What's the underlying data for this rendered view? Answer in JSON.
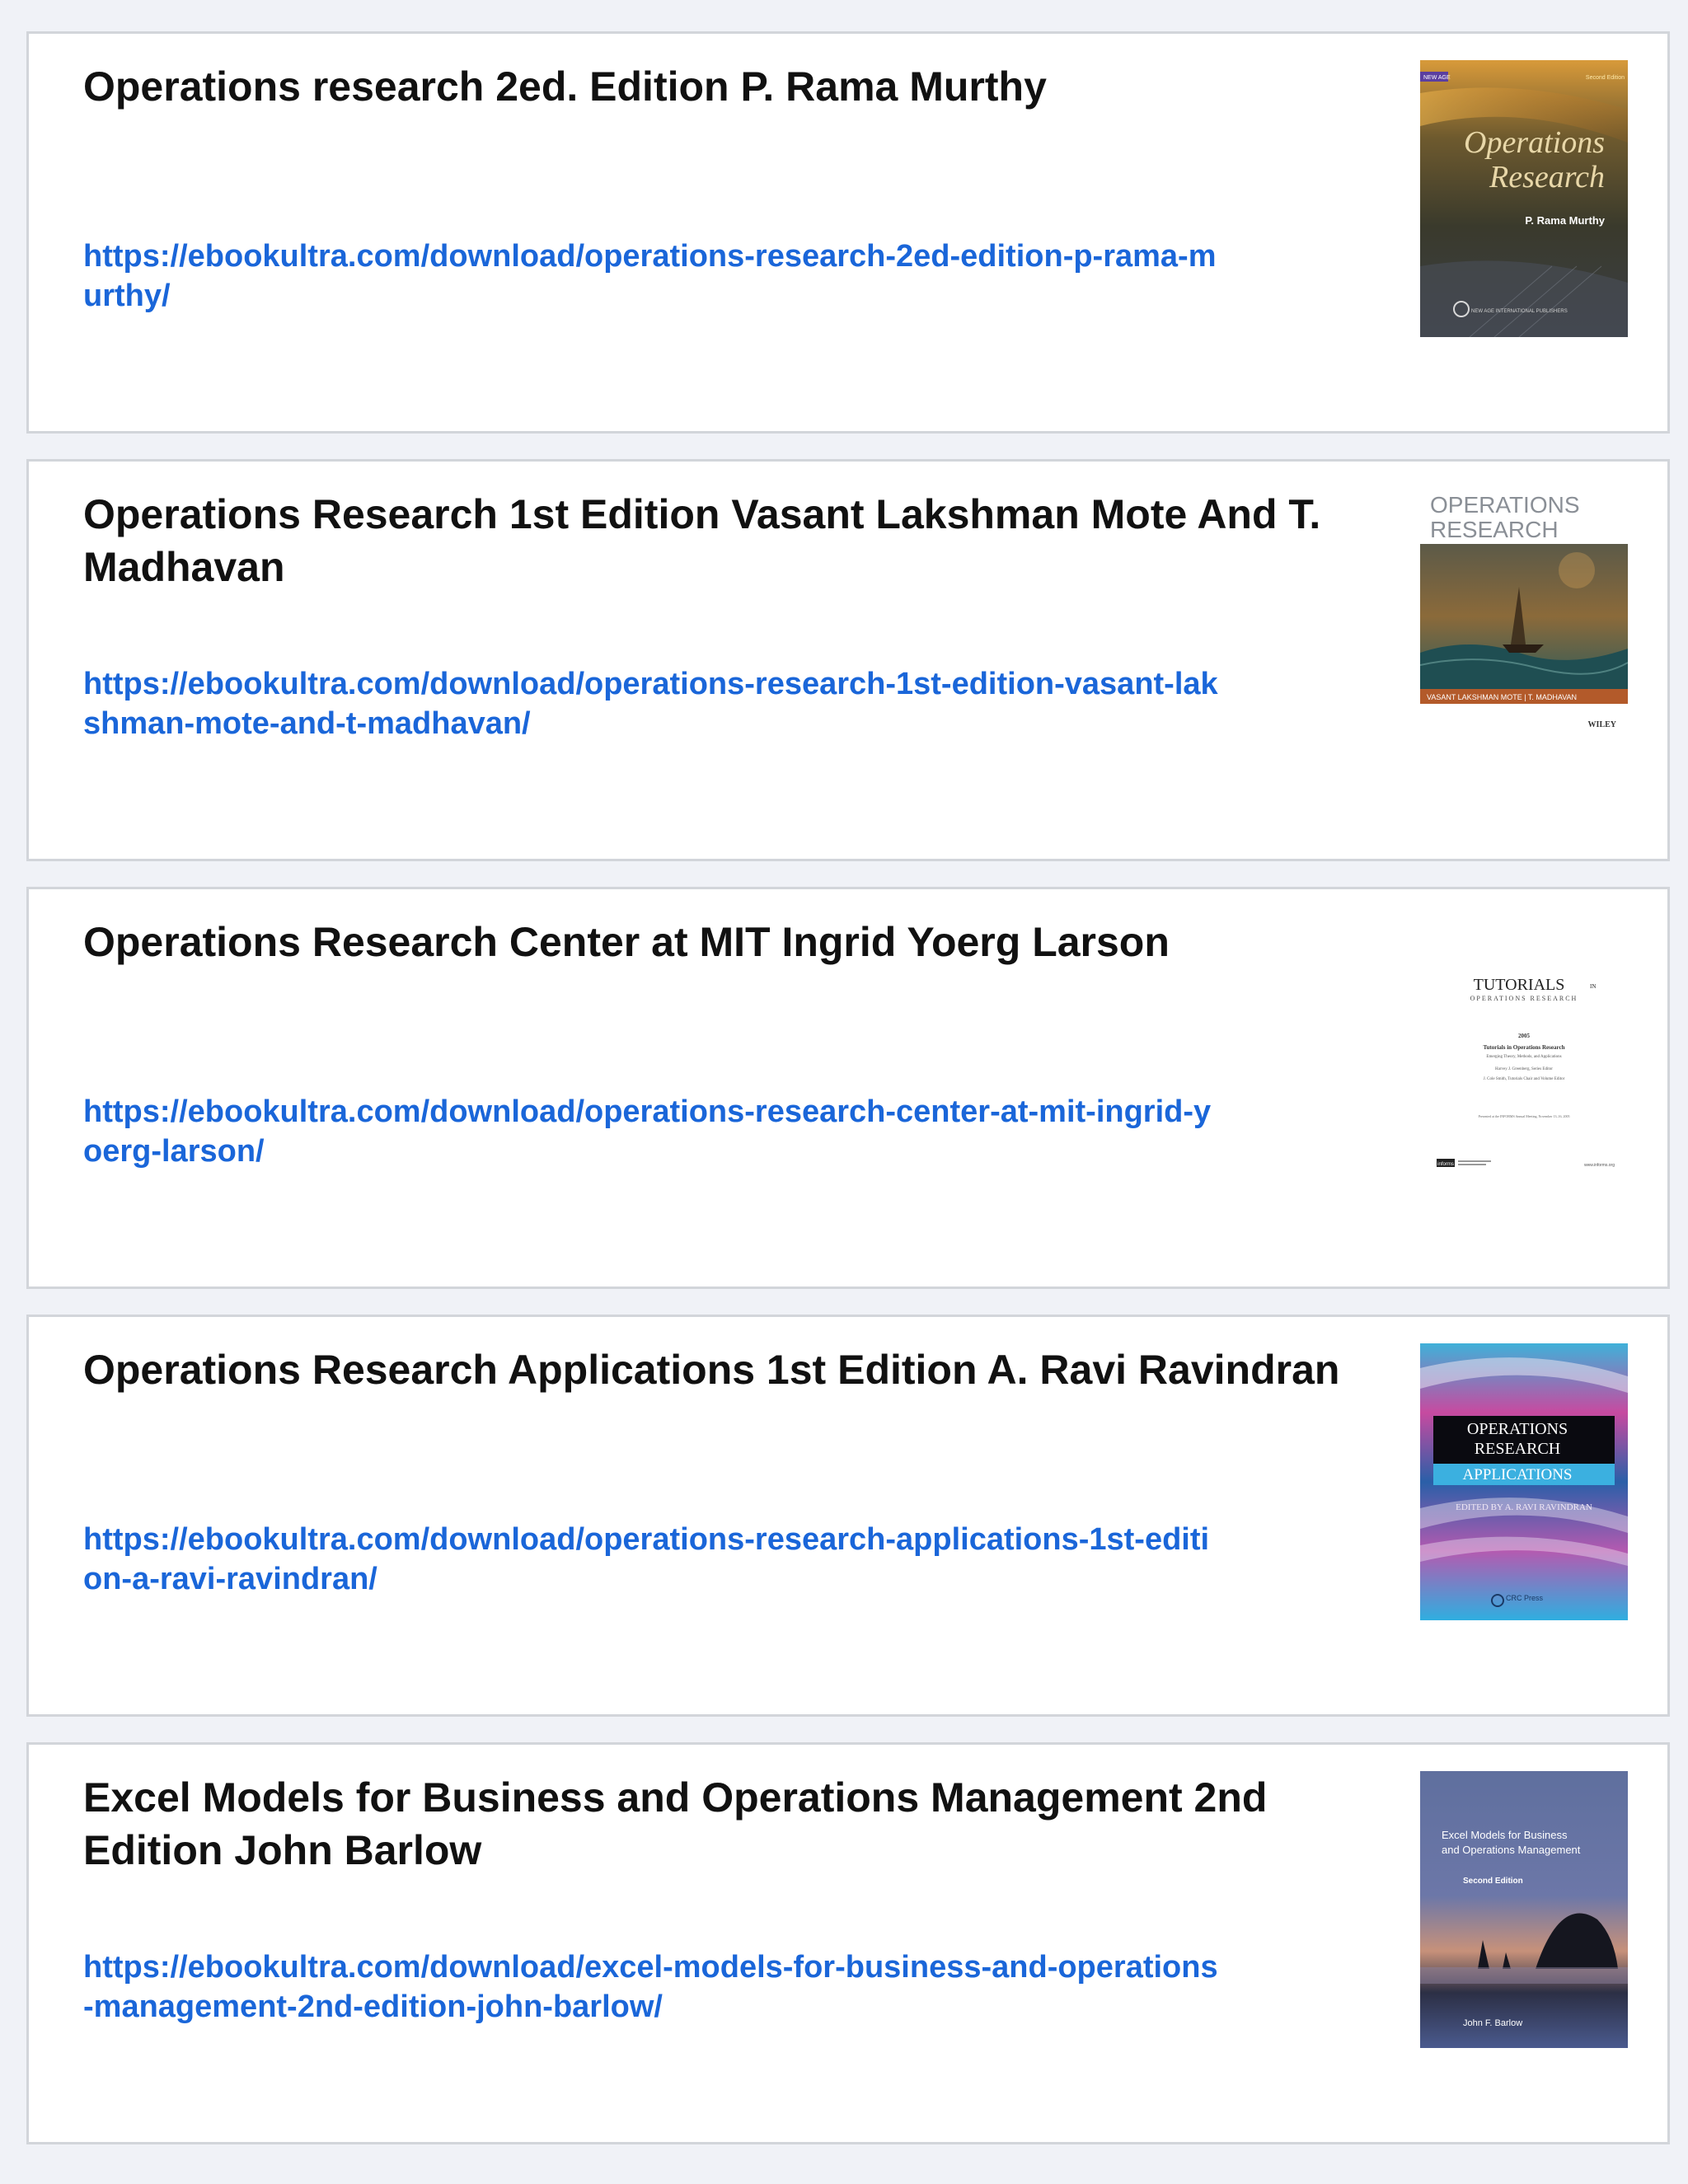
{
  "results": [
    {
      "title": "Operations research 2ed. Edition P. Rama Murthy",
      "url": "https://ebookultra.com/download/operations-research-2ed-edition-p-rama-murthy/",
      "cover": {
        "top_left_tag": "NEW AGE",
        "top_right_tag": "Second Edition",
        "title_line1": "Operations",
        "title_line2": "Research",
        "author": "P. Rama Murthy",
        "publisher": "NEW AGE INTERNATIONAL PUBLISHERS"
      }
    },
    {
      "title": "Operations Research 1st Edition Vasant Lakshman Mote And T. Madhavan",
      "url": "https://ebookultra.com/download/operations-research-1st-edition-vasant-lakshman-mote-and-t-madhavan/",
      "cover": {
        "title_line1": "OPERATIONS",
        "title_line2": "RESEARCH",
        "authors": "VASANT LAKSHMAN MOTE | T. MADHAVAN",
        "publisher": "WILEY"
      }
    },
    {
      "title": "Operations Research Center at MIT Ingrid Yoerg Larson",
      "url": "https://ebookultra.com/download/operations-research-center-at-mit-ingrid-yoerg-larson/",
      "cover": {
        "title": "TUTORIALS",
        "title_suffix": "IN",
        "subtitle": "OPERATIONS RESEARCH",
        "year": "2005",
        "heading": "Tutorials in Operations Research",
        "subheading": "Emerging Theory, Methods, and Applications",
        "editor_line1": "Harvey J. Greenberg, Series Editor",
        "editor_line2": "J. Cole Smith, Tutorials Chair and Volume Editor",
        "footer_note": "Presented at the INFORMS Annual Meeting, November 13–16, 2005",
        "footer_logo": "informs",
        "footer_url": "www.informs.org"
      }
    },
    {
      "title": "Operations Research Applications 1st Edition A. Ravi Ravindran",
      "url": "https://ebookultra.com/download/operations-research-applications-1st-edition-a-ravi-ravindran/",
      "cover": {
        "title_line1": "OPERATIONS",
        "title_line2": "RESEARCH",
        "title_line3": "APPLICATIONS",
        "editor": "EDITED BY A. RAVI RAVINDRAN",
        "publisher": "CRC Press"
      }
    },
    {
      "title": "Excel Models for Business and Operations Management 2nd Edition John Barlow",
      "url": "https://ebookultra.com/download/excel-models-for-business-and-operations-management-2nd-edition-john-barlow/",
      "cover": {
        "title_line1": "Excel Models for Business",
        "title_line2": "and Operations Management",
        "edition": "Second Edition",
        "author": "John F. Barlow"
      }
    }
  ]
}
